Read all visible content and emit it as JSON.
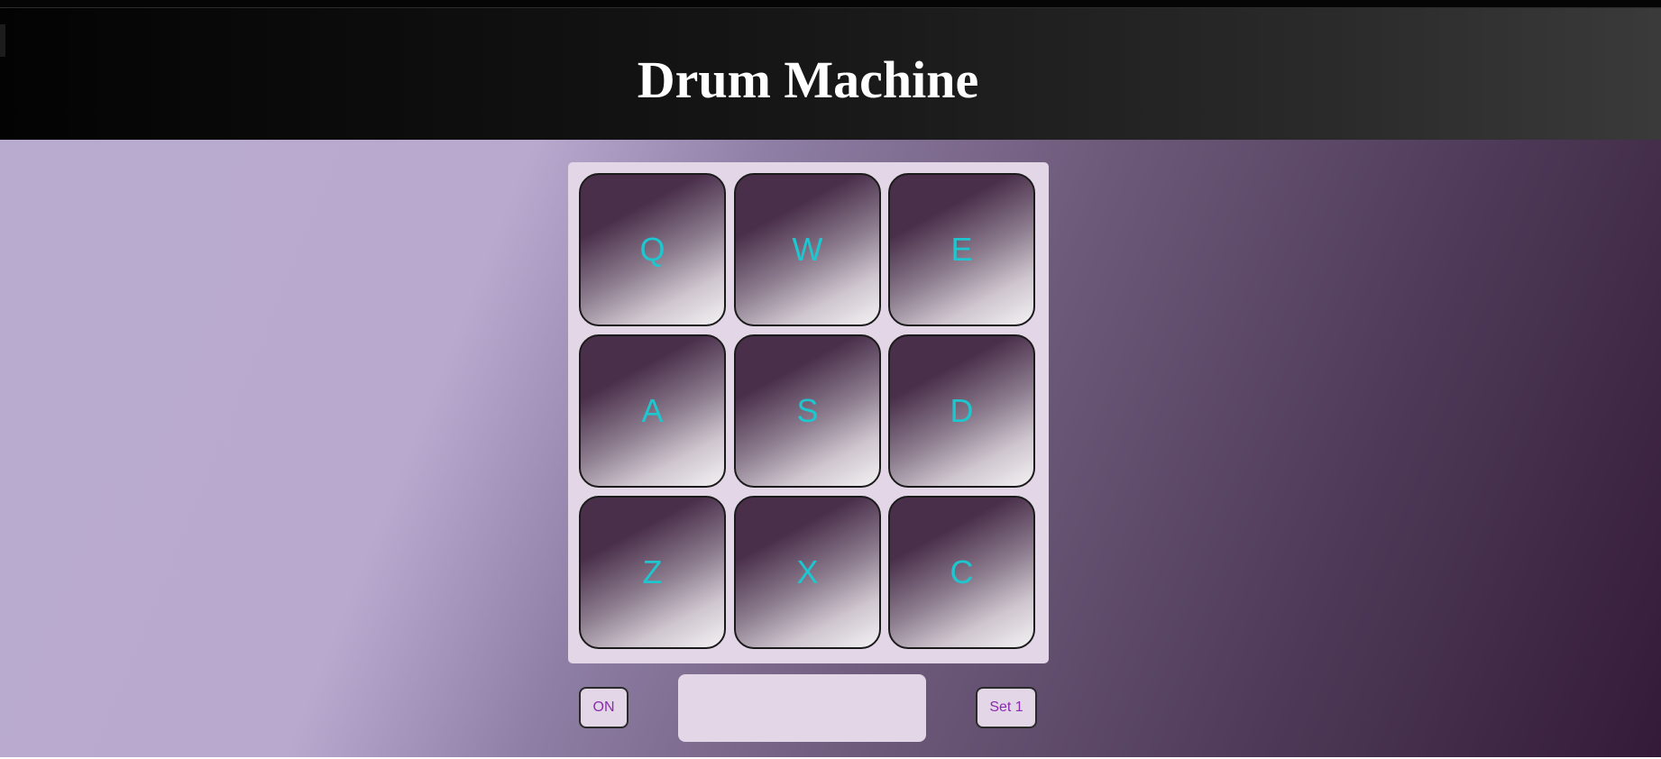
{
  "header": {
    "title": "Drum Machine"
  },
  "pads": [
    {
      "key": "Q"
    },
    {
      "key": "W"
    },
    {
      "key": "E"
    },
    {
      "key": "A"
    },
    {
      "key": "S"
    },
    {
      "key": "D"
    },
    {
      "key": "Z"
    },
    {
      "key": "X"
    },
    {
      "key": "C"
    }
  ],
  "controls": {
    "power_label": "ON",
    "display_text": "",
    "bank_label": "Set 1"
  },
  "colors": {
    "pad_label": "#1ec6cf",
    "control_text": "#8a2bb0",
    "panel": "#e3d6e6",
    "header_bg": "#111111"
  }
}
